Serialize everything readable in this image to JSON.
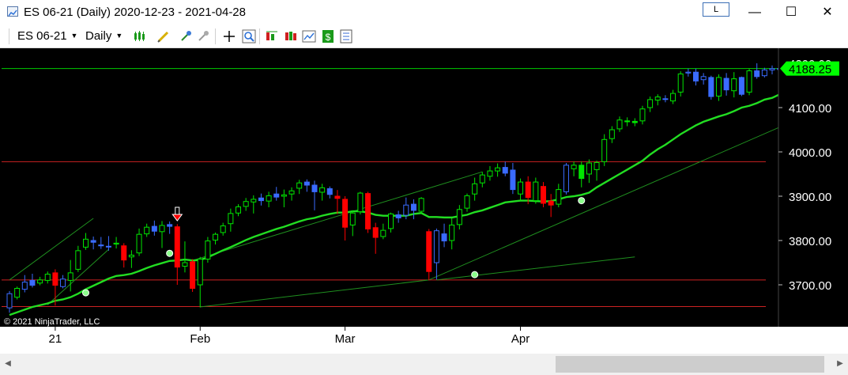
{
  "window": {
    "title": "ES 06-21 (Daily)  2020-12-23 - 2021-04-28",
    "lock_label": "L",
    "minimize": "—",
    "maximize": "☐",
    "close": "✕"
  },
  "toolbar": {
    "instrument": "ES 06-21",
    "period": "Daily",
    "icons": [
      "bar-style-icon",
      "draw-pencil-icon",
      "crosshair-cursor-icon",
      "global-crosshair-icon",
      "move-cross-icon",
      "zoom-icon",
      "indicators-icon",
      "strategies-icon",
      "chart-properties-icon",
      "dollar-icon",
      "data-box-icon"
    ]
  },
  "colors": {
    "background": "#000000",
    "up_candle": "#00e600",
    "down_candle": "#ff0000",
    "blue_candle": "#3a6bff",
    "ma_line": "#22dd22",
    "price_line": "#00cc00",
    "horizontal_line": "#cc2222",
    "trend_line": "#1f8f1f",
    "price_badge": "#00ff00"
  },
  "chart_data": {
    "type": "candlestick",
    "symbol": "ES 06-21",
    "interval": "Daily",
    "date_range": [
      "2020-12-23",
      "2021-04-28"
    ],
    "copyright": "© 2021 NinjaTrader, LLC",
    "last_price_label": "4188.25",
    "y_axis": {
      "ticks": [
        3700,
        3800,
        3900,
        4000,
        4100
      ],
      "tick_labels": [
        "3700.00",
        "3800.00",
        "3900.00",
        "4000.00",
        "4100.00"
      ],
      "range": [
        3630,
        4220
      ]
    },
    "x_axis": {
      "labels": [
        {
          "text": "21",
          "date": "2021-01-04"
        },
        {
          "text": "Feb",
          "date": "2021-02-01"
        },
        {
          "text": "Mar",
          "date": "2021-03-01"
        },
        {
          "text": "Apr",
          "date": "2021-04-01"
        }
      ]
    },
    "candles": [
      {
        "date": "2020-12-23",
        "o": 3648,
        "h": 3686,
        "l": 3637,
        "c": 3680,
        "color": "blue"
      },
      {
        "date": "2020-12-24",
        "o": 3672,
        "h": 3696,
        "l": 3667,
        "c": 3692,
        "color": "green"
      },
      {
        "date": "2020-12-28",
        "o": 3690,
        "h": 3722,
        "l": 3683,
        "c": 3706,
        "color": "blue"
      },
      {
        "date": "2020-12-29",
        "o": 3710,
        "h": 3725,
        "l": 3694,
        "c": 3699,
        "color": "blue"
      },
      {
        "date": "2020-12-30",
        "o": 3704,
        "h": 3718,
        "l": 3699,
        "c": 3711,
        "color": "green"
      },
      {
        "date": "2020-12-31",
        "o": 3710,
        "h": 3730,
        "l": 3703,
        "c": 3724,
        "color": "green"
      },
      {
        "date": "2021-01-04",
        "o": 3727,
        "h": 3735,
        "l": 3653,
        "c": 3699,
        "color": "red"
      },
      {
        "date": "2021-01-05",
        "o": 3696,
        "h": 3722,
        "l": 3692,
        "c": 3713,
        "color": "blue"
      },
      {
        "date": "2021-01-06",
        "o": 3710,
        "h": 3756,
        "l": 3685,
        "c": 3727,
        "color": "green"
      },
      {
        "date": "2021-01-07",
        "o": 3735,
        "h": 3788,
        "l": 3729,
        "c": 3777,
        "color": "green"
      },
      {
        "date": "2021-01-08",
        "o": 3785,
        "h": 3817,
        "l": 3779,
        "c": 3803,
        "color": "green"
      },
      {
        "date": "2021-01-11",
        "o": 3800,
        "h": 3809,
        "l": 3780,
        "c": 3796,
        "color": "blue"
      },
      {
        "date": "2021-01-12",
        "o": 3790,
        "h": 3808,
        "l": 3781,
        "c": 3788,
        "color": "blue"
      },
      {
        "date": "2021-01-13",
        "o": 3786,
        "h": 3810,
        "l": 3777,
        "c": 3787,
        "color": "blue"
      },
      {
        "date": "2021-01-14",
        "o": 3792,
        "h": 3808,
        "l": 3782,
        "c": 3794,
        "color": "green"
      },
      {
        "date": "2021-01-15",
        "o": 3788,
        "h": 3794,
        "l": 3739,
        "c": 3756,
        "color": "red"
      },
      {
        "date": "2021-01-19",
        "o": 3763,
        "h": 3778,
        "l": 3738,
        "c": 3767,
        "color": "green"
      },
      {
        "date": "2021-01-20",
        "o": 3772,
        "h": 3827,
        "l": 3765,
        "c": 3814,
        "color": "green"
      },
      {
        "date": "2021-01-21",
        "o": 3815,
        "h": 3838,
        "l": 3808,
        "c": 3830,
        "color": "green"
      },
      {
        "date": "2021-01-22",
        "o": 3832,
        "h": 3845,
        "l": 3811,
        "c": 3821,
        "color": "blue"
      },
      {
        "date": "2021-01-25",
        "o": 3820,
        "h": 3844,
        "l": 3783,
        "c": 3834,
        "color": "green"
      },
      {
        "date": "2021-01-26",
        "o": 3836,
        "h": 3843,
        "l": 3815,
        "c": 3832,
        "color": "blue"
      },
      {
        "date": "2021-01-27",
        "o": 3831,
        "h": 3837,
        "l": 3700,
        "c": 3740,
        "color": "red"
      },
      {
        "date": "2021-01-28",
        "o": 3742,
        "h": 3798,
        "l": 3728,
        "c": 3750,
        "color": "green"
      },
      {
        "date": "2021-01-29",
        "o": 3752,
        "h": 3758,
        "l": 3684,
        "c": 3692,
        "color": "red"
      },
      {
        "date": "2021-02-01",
        "o": 3700,
        "h": 3763,
        "l": 3649,
        "c": 3758,
        "color": "green"
      },
      {
        "date": "2021-02-02",
        "o": 3758,
        "h": 3808,
        "l": 3750,
        "c": 3799,
        "color": "green"
      },
      {
        "date": "2021-02-03",
        "o": 3801,
        "h": 3818,
        "l": 3791,
        "c": 3814,
        "color": "green"
      },
      {
        "date": "2021-02-04",
        "o": 3818,
        "h": 3840,
        "l": 3811,
        "c": 3833,
        "color": "green"
      },
      {
        "date": "2021-02-05",
        "o": 3838,
        "h": 3872,
        "l": 3820,
        "c": 3861,
        "color": "green"
      },
      {
        "date": "2021-02-08",
        "o": 3862,
        "h": 3882,
        "l": 3855,
        "c": 3876,
        "color": "green"
      },
      {
        "date": "2021-02-09",
        "o": 3877,
        "h": 3896,
        "l": 3867,
        "c": 3888,
        "color": "green"
      },
      {
        "date": "2021-02-10",
        "o": 3887,
        "h": 3902,
        "l": 3861,
        "c": 3893,
        "color": "green"
      },
      {
        "date": "2021-02-11",
        "o": 3896,
        "h": 3906,
        "l": 3879,
        "c": 3890,
        "color": "blue"
      },
      {
        "date": "2021-02-12",
        "o": 3889,
        "h": 3910,
        "l": 3875,
        "c": 3901,
        "color": "green"
      },
      {
        "date": "2021-02-16",
        "o": 3905,
        "h": 3921,
        "l": 3890,
        "c": 3898,
        "color": "blue"
      },
      {
        "date": "2021-02-17",
        "o": 3900,
        "h": 3915,
        "l": 3875,
        "c": 3903,
        "color": "green"
      },
      {
        "date": "2021-02-18",
        "o": 3905,
        "h": 3920,
        "l": 3890,
        "c": 3912,
        "color": "green"
      },
      {
        "date": "2021-02-19",
        "o": 3918,
        "h": 3937,
        "l": 3905,
        "c": 3930,
        "color": "green"
      },
      {
        "date": "2021-02-22",
        "o": 3932,
        "h": 3938,
        "l": 3910,
        "c": 3925,
        "color": "blue"
      },
      {
        "date": "2021-02-23",
        "o": 3925,
        "h": 3935,
        "l": 3868,
        "c": 3910,
        "color": "blue"
      },
      {
        "date": "2021-02-24",
        "o": 3909,
        "h": 3928,
        "l": 3890,
        "c": 3919,
        "color": "green"
      },
      {
        "date": "2021-02-25",
        "o": 3917,
        "h": 3922,
        "l": 3895,
        "c": 3904,
        "color": "blue"
      },
      {
        "date": "2021-02-26",
        "o": 3900,
        "h": 3914,
        "l": 3860,
        "c": 3895,
        "color": "red"
      },
      {
        "date": "2021-03-01",
        "o": 3893,
        "h": 3900,
        "l": 3800,
        "c": 3830,
        "color": "red"
      },
      {
        "date": "2021-03-02",
        "o": 3835,
        "h": 3868,
        "l": 3810,
        "c": 3862,
        "color": "green"
      },
      {
        "date": "2021-03-03",
        "o": 3865,
        "h": 3910,
        "l": 3859,
        "c": 3907,
        "color": "green"
      },
      {
        "date": "2021-03-04",
        "o": 3906,
        "h": 3910,
        "l": 3817,
        "c": 3826,
        "color": "red"
      },
      {
        "date": "2021-03-05",
        "o": 3829,
        "h": 3840,
        "l": 3770,
        "c": 3807,
        "color": "red"
      },
      {
        "date": "2021-03-08",
        "o": 3809,
        "h": 3838,
        "l": 3803,
        "c": 3823,
        "color": "green"
      },
      {
        "date": "2021-03-09",
        "o": 3827,
        "h": 3863,
        "l": 3818,
        "c": 3860,
        "color": "green"
      },
      {
        "date": "2021-03-10",
        "o": 3858,
        "h": 3867,
        "l": 3840,
        "c": 3851,
        "color": "blue"
      },
      {
        "date": "2021-03-11",
        "o": 3857,
        "h": 3897,
        "l": 3848,
        "c": 3880,
        "color": "blue"
      },
      {
        "date": "2021-03-12",
        "o": 3882,
        "h": 3893,
        "l": 3848,
        "c": 3868,
        "color": "blue"
      },
      {
        "date": "2021-03-15",
        "o": 3866,
        "h": 3898,
        "l": 3860,
        "c": 3895,
        "color": "green"
      },
      {
        "date": "2021-03-16",
        "o": 3820,
        "h": 3826,
        "l": 3710,
        "c": 3730,
        "color": "red"
      },
      {
        "date": "2021-03-17",
        "o": 3750,
        "h": 3827,
        "l": 3712,
        "c": 3822,
        "color": "blue"
      },
      {
        "date": "2021-03-18",
        "o": 3815,
        "h": 3838,
        "l": 3785,
        "c": 3799,
        "color": "blue"
      },
      {
        "date": "2021-03-19",
        "o": 3800,
        "h": 3850,
        "l": 3780,
        "c": 3835,
        "color": "green"
      },
      {
        "date": "2021-03-22",
        "o": 3836,
        "h": 3880,
        "l": 3825,
        "c": 3870,
        "color": "green"
      },
      {
        "date": "2021-03-23",
        "o": 3873,
        "h": 3906,
        "l": 3865,
        "c": 3901,
        "color": "green"
      },
      {
        "date": "2021-03-24",
        "o": 3905,
        "h": 3942,
        "l": 3890,
        "c": 3928,
        "color": "green"
      },
      {
        "date": "2021-03-25",
        "o": 3930,
        "h": 3955,
        "l": 3920,
        "c": 3948,
        "color": "green"
      },
      {
        "date": "2021-03-26",
        "o": 3945,
        "h": 3968,
        "l": 3935,
        "c": 3957,
        "color": "green"
      },
      {
        "date": "2021-03-29",
        "o": 3957,
        "h": 3974,
        "l": 3944,
        "c": 3964,
        "color": "green"
      },
      {
        "date": "2021-03-30",
        "o": 3965,
        "h": 3978,
        "l": 3945,
        "c": 3952,
        "color": "blue"
      },
      {
        "date": "2021-03-31",
        "o": 3959,
        "h": 3975,
        "l": 3905,
        "c": 3915,
        "color": "blue"
      },
      {
        "date": "2021-04-01",
        "o": 3905,
        "h": 3940,
        "l": 3890,
        "c": 3932,
        "color": "green"
      },
      {
        "date": "2021-04-05",
        "o": 3932,
        "h": 3945,
        "l": 3882,
        "c": 3897,
        "color": "red"
      },
      {
        "date": "2021-04-06",
        "o": 3890,
        "h": 3942,
        "l": 3883,
        "c": 3932,
        "color": "green"
      },
      {
        "date": "2021-04-07",
        "o": 3922,
        "h": 3932,
        "l": 3875,
        "c": 3884,
        "color": "red"
      },
      {
        "date": "2021-04-08",
        "o": 3889,
        "h": 3905,
        "l": 3853,
        "c": 3880,
        "color": "red"
      },
      {
        "date": "2021-04-09",
        "o": 3882,
        "h": 3928,
        "l": 3875,
        "c": 3915,
        "color": "green"
      },
      {
        "date": "2021-04-12",
        "o": 3910,
        "h": 3975,
        "l": 3904,
        "c": 3970,
        "color": "blue"
      },
      {
        "date": "2021-04-13",
        "o": 3962,
        "h": 3978,
        "l": 3945,
        "c": 3970,
        "color": "green"
      },
      {
        "date": "2021-04-14",
        "o": 3970,
        "h": 3978,
        "l": 3920,
        "c": 3940,
        "color": "green"
      },
      {
        "date": "2021-04-15",
        "o": 3950,
        "h": 3983,
        "l": 3930,
        "c": 3975,
        "color": "green"
      },
      {
        "date": "2021-04-16",
        "o": 3960,
        "h": 3980,
        "l": 3935,
        "c": 3976,
        "color": "green"
      },
      {
        "date": "2021-04-19",
        "o": 3978,
        "h": 4040,
        "l": 3968,
        "c": 4028,
        "color": "green"
      },
      {
        "date": "2021-04-20",
        "o": 4030,
        "h": 4058,
        "l": 4020,
        "c": 4050,
        "color": "green"
      },
      {
        "date": "2021-04-21",
        "o": 4052,
        "h": 4080,
        "l": 4045,
        "c": 4072,
        "color": "green"
      },
      {
        "date": "2021-04-22",
        "o": 4070,
        "h": 4078,
        "l": 4058,
        "c": 4068,
        "color": "green"
      },
      {
        "date": "2021-04-23",
        "o": 4069,
        "h": 4076,
        "l": 4058,
        "c": 4066,
        "color": "green"
      },
      {
        "date": "2021-04-26",
        "o": 4070,
        "h": 4104,
        "l": 4062,
        "c": 4097,
        "color": "green"
      },
      {
        "date": "2021-04-27",
        "o": 4100,
        "h": 4125,
        "l": 4090,
        "c": 4118,
        "color": "green"
      },
      {
        "date": "2021-04-28",
        "o": 4117,
        "h": 4130,
        "l": 4105,
        "c": 4124,
        "color": "green"
      },
      {
        "date": "2021-04-29",
        "o": 4120,
        "h": 4128,
        "l": 4112,
        "c": 4120,
        "color": "blue"
      },
      {
        "date": "2021-04-30",
        "o": 4115,
        "h": 4140,
        "l": 4108,
        "c": 4132,
        "color": "green"
      },
      {
        "date": "2021-05-03",
        "o": 4135,
        "h": 4182,
        "l": 4125,
        "c": 4176,
        "color": "green"
      },
      {
        "date": "2021-05-04",
        "o": 4178,
        "h": 4188,
        "l": 4170,
        "c": 4180,
        "color": "blue"
      },
      {
        "date": "2021-05-05",
        "o": 4180,
        "h": 4188,
        "l": 4150,
        "c": 4160,
        "color": "blue"
      },
      {
        "date": "2021-05-06",
        "o": 4163,
        "h": 4178,
        "l": 4152,
        "c": 4170,
        "color": "blue"
      },
      {
        "date": "2021-05-07",
        "o": 4168,
        "h": 4172,
        "l": 4118,
        "c": 4125,
        "color": "blue"
      },
      {
        "date": "2021-05-10",
        "o": 4126,
        "h": 4175,
        "l": 4115,
        "c": 4168,
        "color": "green"
      },
      {
        "date": "2021-05-11",
        "o": 4166,
        "h": 4178,
        "l": 4127,
        "c": 4140,
        "color": "blue"
      },
      {
        "date": "2021-05-12",
        "o": 4138,
        "h": 4180,
        "l": 4123,
        "c": 4165,
        "color": "green"
      },
      {
        "date": "2021-05-13",
        "o": 4168,
        "h": 4170,
        "l": 4126,
        "c": 4130,
        "color": "blue"
      },
      {
        "date": "2021-05-14",
        "o": 4135,
        "h": 4188,
        "l": 4128,
        "c": 4183,
        "color": "green"
      },
      {
        "date": "2021-05-17",
        "o": 4183,
        "h": 4200,
        "l": 4165,
        "c": 4170,
        "color": "blue"
      },
      {
        "date": "2021-05-18",
        "o": 4172,
        "h": 4190,
        "l": 4168,
        "c": 4185,
        "color": "blue"
      },
      {
        "date": "2021-05-19",
        "o": 4185,
        "h": 4195,
        "l": 4175,
        "c": 4188,
        "color": "blue"
      },
      {
        "date": "2021-05-20",
        "o": 4186,
        "h": 4200,
        "l": 4180,
        "c": 4188.25,
        "color": "blue"
      }
    ],
    "moving_average": [
      3632,
      3638,
      3644,
      3650,
      3654,
      3658,
      3664,
      3667,
      3672,
      3680,
      3690,
      3698,
      3706,
      3714,
      3720,
      3722,
      3725,
      3731,
      3738,
      3744,
      3749,
      3754,
      3755,
      3757,
      3755,
      3756,
      3762,
      3770,
      3778,
      3785,
      3793,
      3801,
      3808,
      3814,
      3820,
      3826,
      3831,
      3837,
      3843,
      3848,
      3851,
      3856,
      3860,
      3863,
      3863,
      3866,
      3866,
      3863,
      3858,
      3856,
      3856,
      3856,
      3856,
      3860,
      3862,
      3853,
      3853,
      3852,
      3852,
      3855,
      3858,
      3864,
      3868,
      3874,
      3880,
      3886,
      3888,
      3890,
      3890,
      3889,
      3888,
      3889,
      3893,
      3898,
      3900,
      3903,
      3908,
      3920,
      3930,
      3940,
      3950,
      3960,
      3970,
      3980,
      3994,
      4006,
      4016,
      4028,
      4040,
      4050,
      4060,
      4068,
      4074,
      4080,
      4085,
      4092,
      4100,
      4104,
      4110,
      4118,
      4122,
      4130,
      4140
    ],
    "horizontal_lines": [
      3711,
      3978,
      3651
    ],
    "current_price_line": 4188.25,
    "trend_lines": [
      {
        "from": [
          "2020-12-23",
          3711
        ],
        "to": [
          "2021-01-11",
          3850
        ]
      },
      {
        "from": [
          "2020-12-31",
          3655
        ],
        "to": [
          "2021-01-13",
          3780
        ]
      },
      {
        "from": [
          "2021-02-01",
          3650
        ],
        "to": [
          "2021-03-16",
          3711
        ]
      },
      {
        "from": [
          "2021-01-29",
          3755
        ],
        "to": [
          "2021-03-25",
          3955
        ]
      },
      {
        "from": [
          "2021-03-16",
          3711
        ],
        "to": [
          "2021-05-20",
          4056
        ]
      },
      {
        "from": [
          "2021-03-17",
          3711
        ],
        "to": [
          "2021-04-23",
          3763
        ]
      }
    ],
    "markers": [
      {
        "type": "circle",
        "date": "2021-01-08",
        "value": 3682
      },
      {
        "type": "circle",
        "date": "2021-01-26",
        "value": 3771
      },
      {
        "type": "circle",
        "date": "2021-03-24",
        "value": 3723
      },
      {
        "type": "circle",
        "date": "2021-04-14",
        "value": 3890
      },
      {
        "type": "down-arrow",
        "date": "2021-01-27",
        "value": 3850
      }
    ]
  }
}
